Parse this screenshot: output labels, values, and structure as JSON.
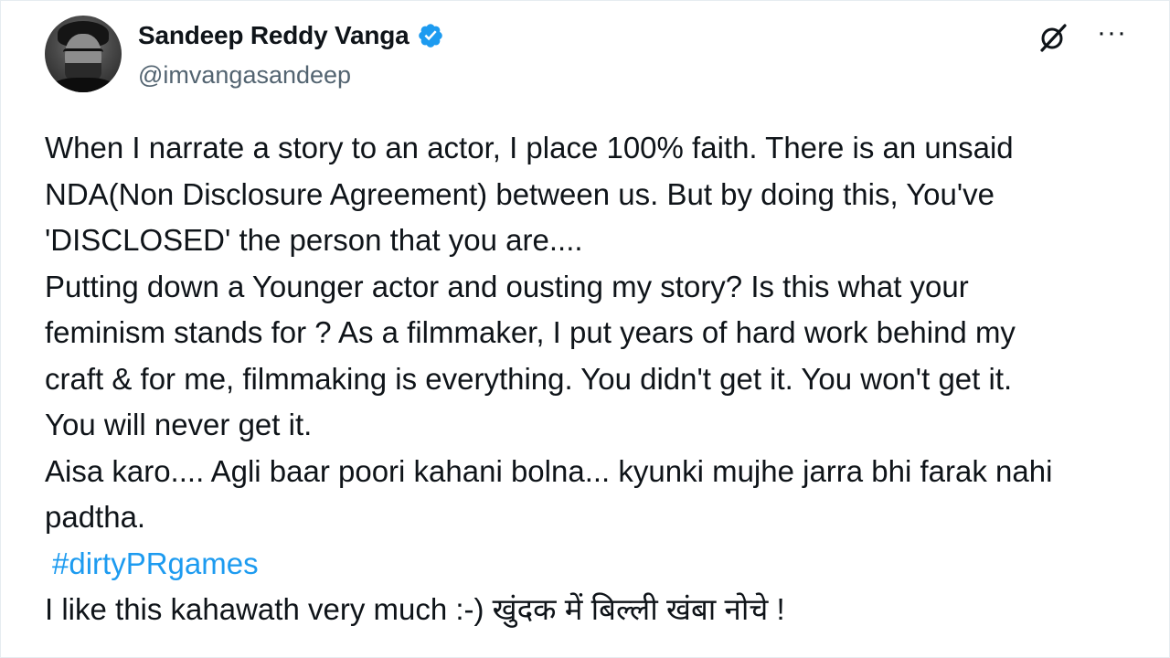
{
  "author": {
    "display_name": "Sandeep Reddy Vanga",
    "handle": "@imvangasandeep",
    "verified": true,
    "avatar_icon": "profile-photo"
  },
  "actions": {
    "grok_icon": "grok-icon",
    "more_label": "···"
  },
  "tweet": {
    "lines": [
      "When I narrate a story to an actor, I place 100% faith. There is an unsaid",
      "NDA(Non Disclosure Agreement) between us. But by doing this, You've",
      "'DISCLOSED' the person that you are....",
      "Putting down a Younger actor and ousting my story?  Is this what your",
      "feminism stands for ? As a filmmaker, I put years of hard work behind my",
      "craft & for me, filmmaking is everything. You didn't get it. You won't get it.",
      "You will never get it.",
      "Aisa karo.... Agli baar poori kahani bolna... kyunki mujhe jarra bhi farak nahi",
      "padtha."
    ],
    "hashtag": "#dirtyPRgames",
    "last_line": "I like this kahawath very much :-) खुंदक में बिल्ली खंबा नोचे !"
  },
  "colors": {
    "link": "#1d9bf0",
    "secondary_text": "#536471",
    "verified_badge": "#1d9bf0"
  }
}
